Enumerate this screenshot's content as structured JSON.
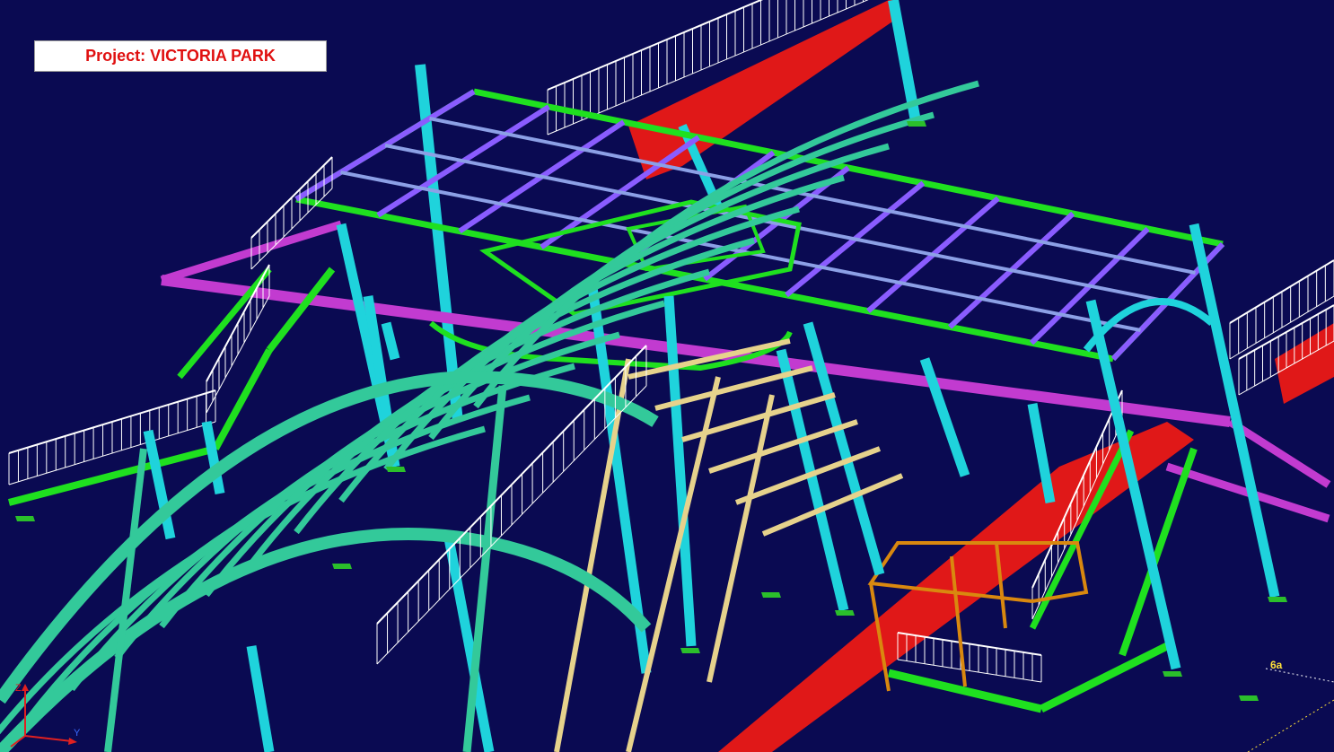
{
  "project_label": "Project: VICTORIA PARK",
  "grid_label": "6a",
  "axis": {
    "z_label": "Z",
    "y_label": "Y"
  },
  "icons": {
    "axis_triad": "axis-triad-icon"
  },
  "colors": {
    "background": "#0a0a52",
    "column": "#1fd3dc",
    "main_beam": "#1fe01f",
    "cross_beam": "#8a5cff",
    "purlin": "#8ca0e6",
    "girder": "#c23bd0",
    "roof_arch": "#33c99a",
    "rafter": "#e6d28c",
    "deck": "#e01818",
    "railing": "#ffffff",
    "frame_orange": "#d9880f",
    "project_text": "#e01010",
    "grid_text": "#ffe23a"
  }
}
